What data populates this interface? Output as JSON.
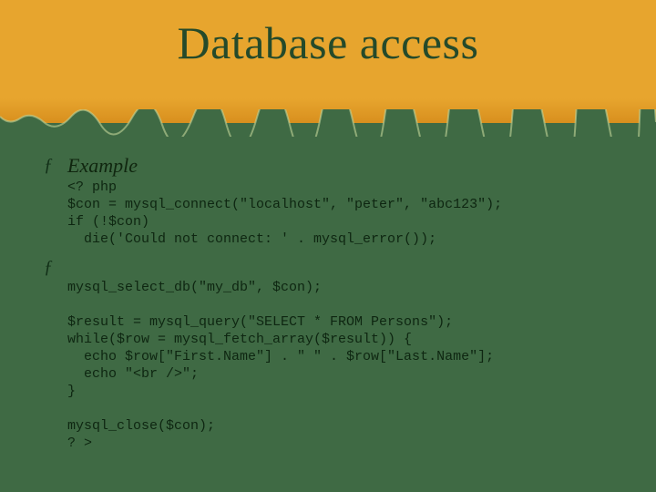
{
  "title": "Database access",
  "bullets": {
    "symbol": "ƒ",
    "label": "Example"
  },
  "code_block_1": "<? php\n$con = mysql_connect(\"localhost\", \"peter\", \"abc123\");\nif (!$con)\n  die('Could not connect: ' . mysql_error());",
  "code_block_2": "mysql_select_db(\"my_db\", $con);\n\n$result = mysql_query(\"SELECT * FROM Persons\");\nwhile($row = mysql_fetch_array($result)) {\n  echo $row[\"First.Name\"] . \" \" . $row[\"Last.Name\"];\n  echo \"<br />\";\n}\n\nmysql_close($con);\n? >"
}
